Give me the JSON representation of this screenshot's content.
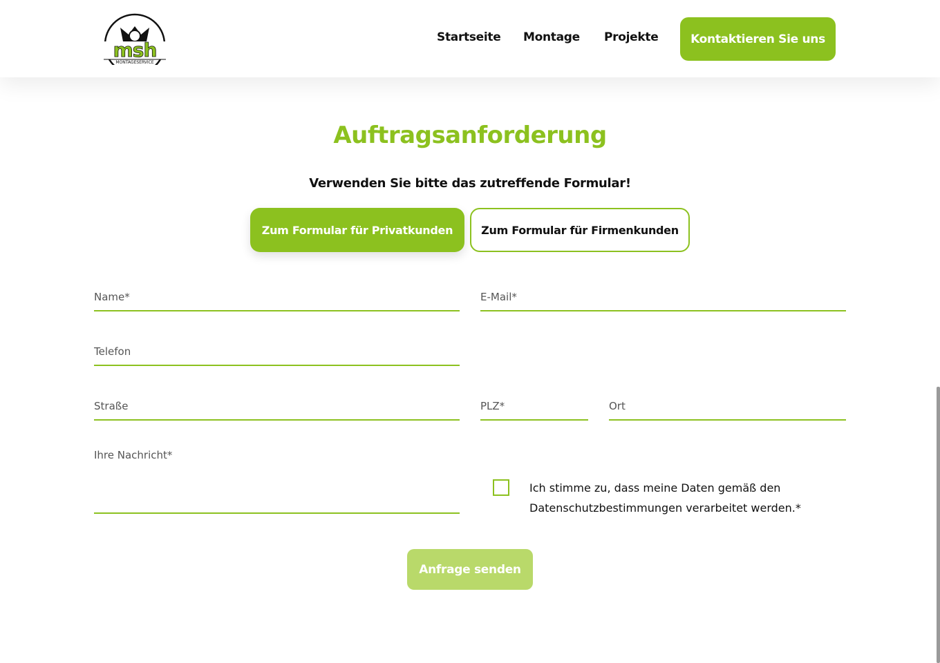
{
  "header": {
    "logo": {
      "text": "msh",
      "subtext": "MONTAGESERVICE",
      "brand_color": "#8cc11f"
    },
    "nav": [
      "Startseite",
      "Montage",
      "Projekte"
    ],
    "cta_label": "Kontaktieren Sie uns"
  },
  "main": {
    "title": "Auftragsanforderung",
    "subtitle": "Verwenden Sie bitte das zutreffende Formular!",
    "form_switch": {
      "private_label": "Zum Formular für Privatkunden",
      "company_label": "Zum Formular für Firmenkunden"
    },
    "form": {
      "name_placeholder": "Name*",
      "email_placeholder": "E-Mail*",
      "phone_placeholder": "Telefon",
      "street_placeholder": "Straße",
      "zip_placeholder": "PLZ*",
      "city_placeholder": "Ort",
      "message_placeholder": "Ihre Nachricht*",
      "consent_text": "Ich stimme zu, dass meine Daten gemäß den Datenschutzbestimmungen verarbeitet werden.*",
      "consent_checked": false,
      "submit_label": "Anfrage senden"
    }
  },
  "colors": {
    "accent": "#8cc11f",
    "accent_disabled": "#b9d96a"
  }
}
